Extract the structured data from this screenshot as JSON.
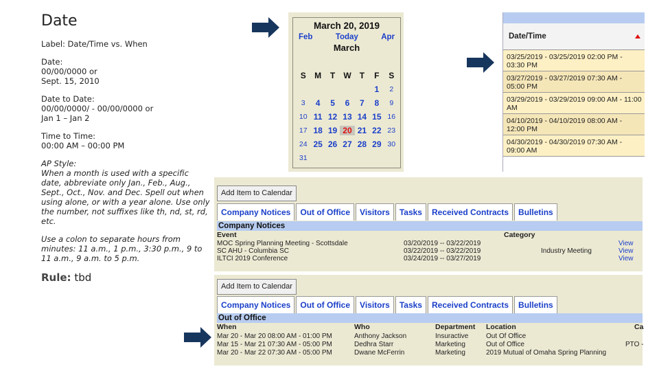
{
  "guidelines": {
    "title": "Date",
    "label_note": "Label: Date/Time vs. When",
    "date_heading": "Date:",
    "date_fmt1": "00/00/0000 or",
    "date_fmt2": "Sept. 15, 2010",
    "range_heading": "Date to Date:",
    "range_fmt1": "00/00/0000/ - 00/00/0000 or",
    "range_fmt2": "Jan 1 – Jan 2",
    "time_heading": "Time to Time:",
    "time_fmt": "00:00 AM – 00:00 PM",
    "ap_heading": "AP Style:",
    "ap_text": "When a month is used with a specific date, abbreviate only Jan., Feb., Aug., Sept., Oct., Nov. and Dec. Spell out when using alone, or with a year alone. Use only the number, not suffixes like th, nd, st, rd, etc.",
    "colon_text": "Use a colon to separate hours from minutes: 11 a.m., 1 p.m., 3:30 p.m., 9 to 11 a.m., 9 a.m. to 5 p.m.",
    "rule_label": "Rule:",
    "rule_value": "tbd"
  },
  "calendar": {
    "title": "March 20, 2019",
    "prev": "Feb",
    "today": "Today",
    "next": "Apr",
    "month": "March",
    "dows": [
      "S",
      "M",
      "T",
      "W",
      "T",
      "F",
      "S"
    ],
    "weeks": [
      [
        "",
        "",
        "",
        "",
        "",
        "1",
        "2"
      ],
      [
        "3",
        "4",
        "5",
        "6",
        "7",
        "8",
        "9"
      ],
      [
        "10",
        "11",
        "12",
        "13",
        "14",
        "15",
        "16"
      ],
      [
        "17",
        "18",
        "19",
        "20",
        "21",
        "22",
        "23"
      ],
      [
        "24",
        "25",
        "26",
        "27",
        "28",
        "29",
        "30"
      ],
      [
        "31",
        "",
        "",
        "",
        "",
        "",
        ""
      ]
    ],
    "selected": "20"
  },
  "datetime_list": {
    "header": "Date/Time",
    "items": [
      "03/25/2019 - 03/25/2019  02:00 PM - 03:30 PM",
      "03/27/2019 - 03/27/2019  07:30 AM - 05:00 PM",
      "03/29/2019 - 03/29/2019  09:00 AM - 11:00 AM",
      "04/10/2019 - 04/10/2019  08:00 AM - 12:00 PM",
      "04/30/2019 - 04/30/2019  07:30 AM - 09:00 AM"
    ]
  },
  "panel1": {
    "add_button": "Add Item to Calendar",
    "tabs": [
      "Company Notices",
      "Out of Office",
      "Visitors",
      "Tasks",
      "Received Contracts",
      "Bulletins"
    ],
    "section": "Company Notices",
    "col_event": "Event",
    "col_category": "Category",
    "rows": [
      {
        "event": "MOC Spring Planning Meeting - Scottsdale",
        "dates": "03/20/2019 -- 03/22/2019",
        "category": "",
        "view": "View"
      },
      {
        "event": "SC AHU - Columbia SC",
        "dates": "03/22/2019 -- 03/22/2019",
        "category": "Industry Meeting",
        "view": "View"
      },
      {
        "event": "ILTCI 2019 Conference",
        "dates": "03/24/2019 -- 03/27/2019",
        "category": "",
        "view": "View"
      }
    ]
  },
  "panel2": {
    "add_button": "Add Item to Calendar",
    "tabs": [
      "Company Notices",
      "Out of Office",
      "Visitors",
      "Tasks",
      "Received Contracts",
      "Bulletins"
    ],
    "section": "Out of Office",
    "cols": {
      "when": "When",
      "who": "Who",
      "dept": "Department",
      "loc": "Location",
      "cat": "Ca"
    },
    "rows": [
      {
        "when": "Mar 20 - Mar 20   08:00 AM - 01:00 PM",
        "who": "Anthony Jackson",
        "dept": "Insuractive",
        "loc": "Out Of Office",
        "cat": ""
      },
      {
        "when": "Mar 15 - Mar 21   07:30 AM - 05:00 PM",
        "who": "Dedhra Starr",
        "dept": "Marketing",
        "loc": "Out of Office",
        "cat": "PTO -"
      },
      {
        "when": "Mar 20 - Mar 22   07:30 AM - 05:00 PM",
        "who": "Dwane McFerrin",
        "dept": "Marketing",
        "loc": "2019 Mutual of Omaha Spring Planning",
        "cat": ""
      }
    ]
  },
  "colors": {
    "arrow": "#17365d",
    "link": "#1a3fc9",
    "panel_bg": "#ece9d3",
    "header_blue": "#b7ccf0",
    "row_yellow": "#fdf0c4"
  },
  "icons": [
    "right-arrow-icon",
    "sort-ascending-icon"
  ]
}
